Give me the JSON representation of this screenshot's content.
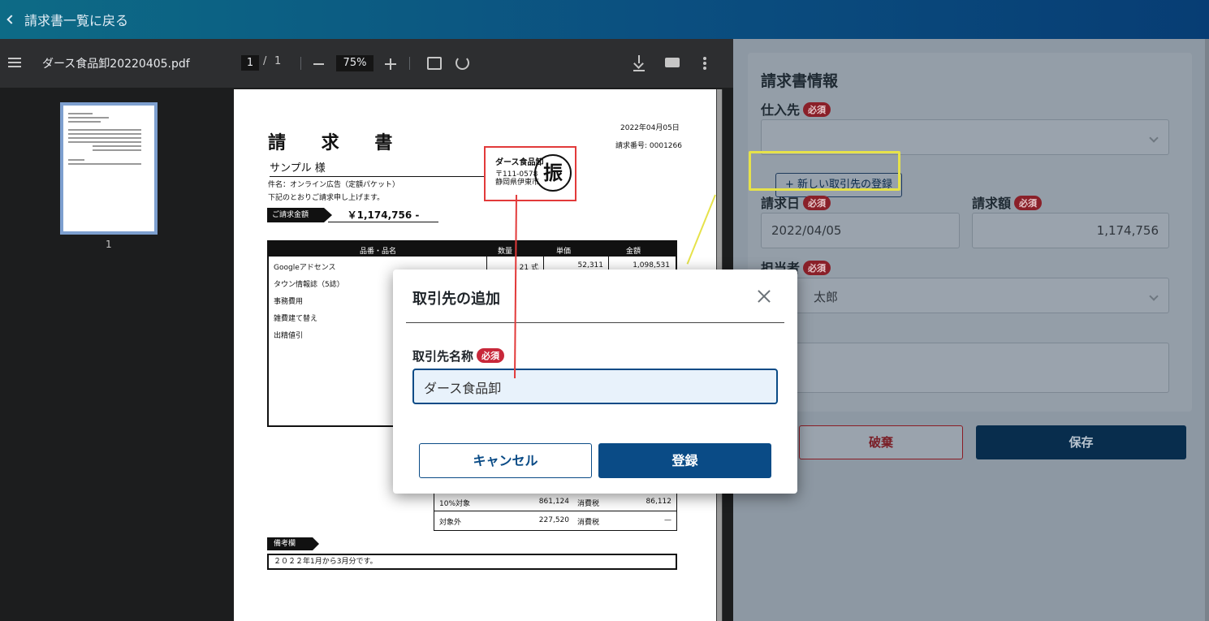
{
  "topbar": {
    "back_label": "請求書一覧に戻る"
  },
  "viewer": {
    "filename": "ダース食品卸20220405.pdf",
    "page_current": "1",
    "page_sep": "/",
    "page_total": "1",
    "zoom": "75%",
    "thumb_label": "1"
  },
  "invoice": {
    "title": "請 求 書",
    "date": "2022年04月05日",
    "number": "請求番号: 0001266",
    "customer": "サンプル 様",
    "subject": "件名：オンライン広告（定額パケット）",
    "request_text": "下記のとおりご請求申し上げます。",
    "amount_label": "ご請求金額",
    "amount": "￥1,174,756 -",
    "issuer_name": "ダース食品卸",
    "issuer_zip": "〒111-0578",
    "issuer_addr": "静岡県伊東市",
    "stamp": "振",
    "headers": [
      "品番・品名",
      "数量",
      "単価",
      "金額"
    ],
    "items": [
      {
        "name": "Googleアドセンス",
        "qty": "21 式",
        "price": "52,311",
        "amount": "1,098,531"
      },
      {
        "name": "タウン情報誌（5誌）",
        "qty": "",
        "price": "",
        "amount": ""
      },
      {
        "name": "事務費用",
        "qty": "",
        "price": "",
        "amount": ""
      },
      {
        "name": "雑費建て替え",
        "qty": "",
        "price": "",
        "amount": ""
      },
      {
        "name": "出精値引",
        "qty": "",
        "price": "",
        "amount": ""
      }
    ],
    "summary": [
      {
        "label": "10%対象",
        "value": "861,124",
        "tax_label": "消費税",
        "tax": "86,112"
      },
      {
        "label": "対象外",
        "value": "227,520",
        "tax_label": "消費税",
        "tax": "—"
      }
    ],
    "memo_label": "備考欄",
    "memo": "２０２２年1月から3月分です。"
  },
  "form": {
    "title": "請求書情報",
    "supplier_label": "仕入先",
    "required": "必須",
    "supplier_value": "",
    "new_partner_button": "+ 新しい取引先の登録",
    "date_label": "請求日",
    "date_value": "2022/04/05",
    "amount_label": "請求額",
    "amount_value": "1,174,756",
    "owner_label": "担当者",
    "owner_value": "太郎",
    "discard": "破棄",
    "save": "保存"
  },
  "modal": {
    "title": "取引先の追加",
    "field_label": "取引先名称",
    "required": "必須",
    "input_value": "ダース食品卸",
    "cancel": "キャンセル",
    "submit": "登録"
  }
}
